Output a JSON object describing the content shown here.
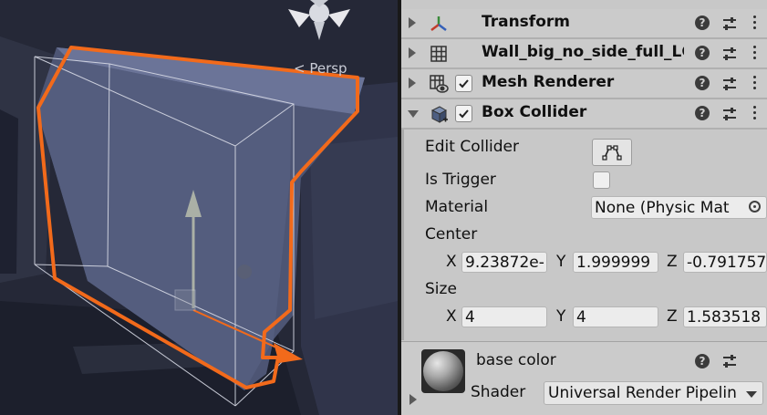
{
  "scene": {
    "camera_label": "< Persp"
  },
  "inspector": {
    "components": [
      {
        "name": "Transform",
        "icon": "transform-icon",
        "has_checkbox": false,
        "expanded": false
      },
      {
        "name": "Wall_big_no_side_full_LC",
        "icon": "mesh-filter-icon",
        "has_checkbox": false,
        "expanded": false
      },
      {
        "name": "Mesh Renderer",
        "icon": "mesh-renderer-icon",
        "has_checkbox": true,
        "checked": true,
        "expanded": false
      },
      {
        "name": "Box Collider",
        "icon": "box-collider-icon",
        "has_checkbox": true,
        "checked": true,
        "expanded": true
      }
    ],
    "help_glyph": "?",
    "box_collider": {
      "edit_collider_label": "Edit Collider",
      "is_trigger_label": "Is Trigger",
      "is_trigger": false,
      "material_label": "Material",
      "material_value": "None (Physic Mat",
      "center_label": "Center",
      "center": {
        "x_label": "X",
        "x": "9.23872e-",
        "y_label": "Y",
        "y": "1.999999",
        "z_label": "Z",
        "z": "-0.791757"
      },
      "size_label": "Size",
      "size": {
        "x_label": "X",
        "x": "4",
        "y_label": "Y",
        "y": "4",
        "z_label": "Z",
        "z": "1.583518"
      }
    },
    "material": {
      "name": "base color",
      "shader_label": "Shader",
      "shader_value": "Universal Render Pipelin"
    }
  },
  "colors": {
    "selection_outline": "#f26a1b",
    "inspector_bg": "#c8c8c8",
    "scene_bg": "#262a38"
  }
}
